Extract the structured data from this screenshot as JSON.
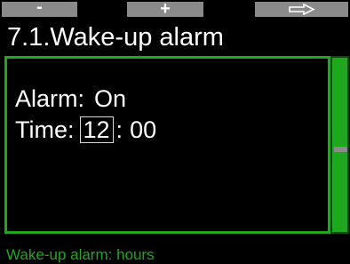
{
  "buttons": {
    "minus_label": "-",
    "plus_label": "+",
    "next_icon": "arrow-right-outline-icon"
  },
  "title": "7.1.Wake-up alarm",
  "settings": {
    "alarm_label": "Alarm:",
    "alarm_value": "On",
    "time_label": "Time:",
    "hours": "12",
    "separator": ":",
    "minutes": "00"
  },
  "status_text": "Wake-up alarm: hours",
  "colors": {
    "accent_green": "#1ea81e",
    "button_gray": "#8a8a8a",
    "background": "#000000",
    "text": "#ffffff"
  }
}
